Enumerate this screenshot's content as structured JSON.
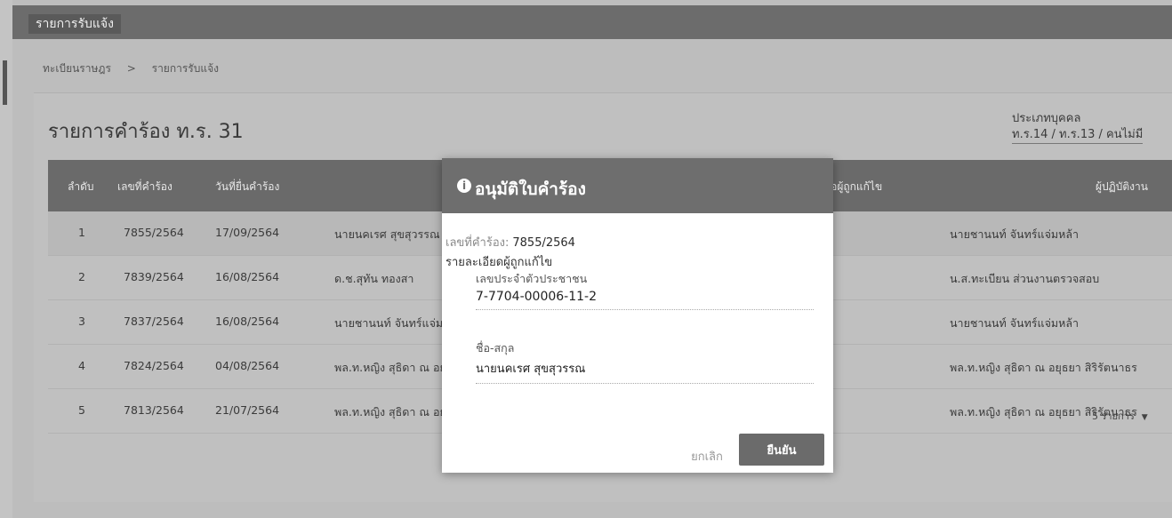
{
  "appbar": {
    "title": "รายการรับแจ้ง"
  },
  "breadcrumb": {
    "items": [
      "ทะเบียนราษฎร",
      ">",
      "รายการรับแจ้ง"
    ]
  },
  "page": {
    "title": "รายการคำร้อง ท.ร. 31",
    "person_type_label": "ประเภทบุคคล",
    "person_type_value": "ท.ร.14 / ท.ร.13 / คนไม่มี"
  },
  "table": {
    "headers": {
      "num": "ลำดับ",
      "req": "เลขที่คำร้อง",
      "date": "วันที่ยื่นคำร้อง",
      "name": "ชื่อผู้ถูกแก้ไข",
      "staff": "ผู้ปฏิบัติงาน"
    },
    "rows": [
      {
        "num": "1",
        "req": "7855/2564",
        "date": "17/09/2564",
        "name": "นายนคเรศ สุขสุวรรณ",
        "staff": "นายชานนท์ จันทร์แจ่มหล้า"
      },
      {
        "num": "2",
        "req": "7839/2564",
        "date": "16/08/2564",
        "name": "ด.ช.สุทัน ทองสา",
        "staff": "น.ส.ทะเบียน ส่วนงานตรวจสอบ"
      },
      {
        "num": "3",
        "req": "7837/2564",
        "date": "16/08/2564",
        "name": "นายชานนท์ จันทร์แจ่มหล้า",
        "staff": "นายชานนท์ จันทร์แจ่มหล้า"
      },
      {
        "num": "4",
        "req": "7824/2564",
        "date": "04/08/2564",
        "name": "พล.ท.หญิง สุธิดา ณ อยุธยา",
        "staff": "พล.ท.หญิง สุธิดา ณ อยุธยา สิริรัตนาธร"
      },
      {
        "num": "5",
        "req": "7813/2564",
        "date": "21/07/2564",
        "name": "พล.ท.หญิง สุธิดา ณ อยุธยา",
        "staff": "พล.ท.หญิง สุธิดา ณ อยุธยา สิริรัตนาธร"
      }
    ],
    "pager_label": "5 รายการ"
  },
  "modal": {
    "title": "อนุมัติใบคำร้อง",
    "req_label": "เลขที่คำร้อง:",
    "req_value": "7855/2564",
    "detail_label": "รายละเอียดผู้ถูกแก้ไข",
    "id_label": "เลขประจำตัวประชาชน",
    "id_value": "7-7704-00006-11-2",
    "name_label": "ชื่อ-สกุล",
    "name_value": "นายนคเรศ สุขสุวรรณ",
    "cancel_label": "ยกเลิก",
    "confirm_label": "ยืนยัน"
  }
}
